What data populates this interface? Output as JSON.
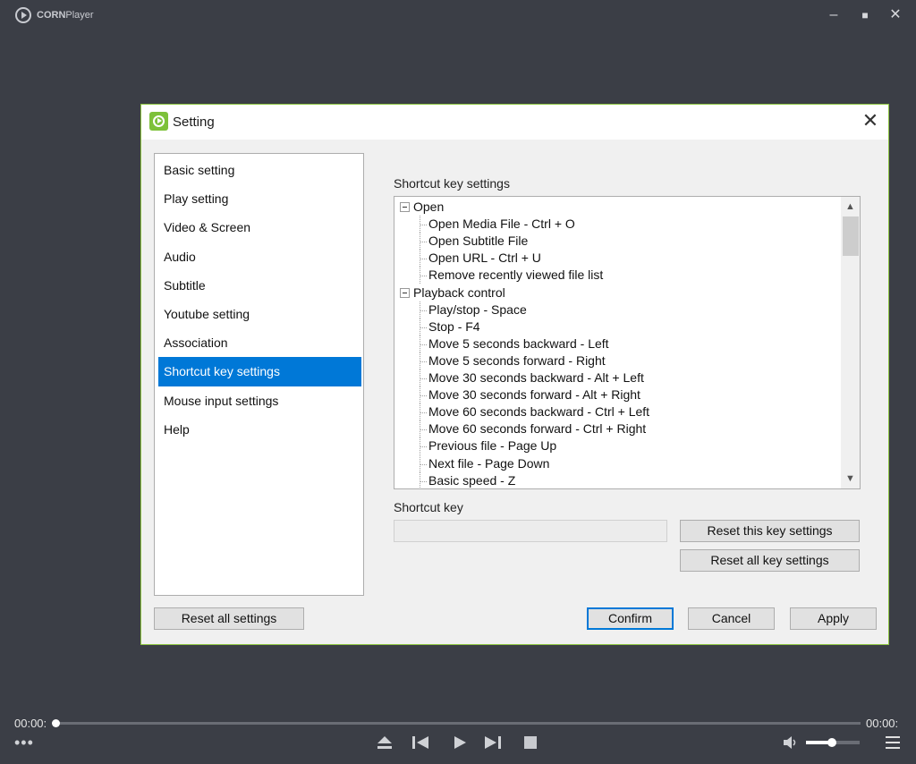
{
  "app": {
    "name_bold": "CORN",
    "name_rest": "Player"
  },
  "window": {
    "minimize": "–",
    "maximize": "■",
    "close": "✕"
  },
  "dialog": {
    "title": "Setting",
    "close": "✕",
    "nav": [
      {
        "label": "Basic setting"
      },
      {
        "label": "Play setting"
      },
      {
        "label": "Video & Screen"
      },
      {
        "label": "Audio"
      },
      {
        "label": "Subtitle"
      },
      {
        "label": "Youtube setting"
      },
      {
        "label": "Association"
      },
      {
        "label": "Shortcut key settings",
        "active": true
      },
      {
        "label": "Mouse input settings"
      },
      {
        "label": "Help"
      }
    ],
    "section_title": "Shortcut key settings",
    "tree": [
      {
        "label": "Open",
        "level": 0
      },
      {
        "label": "Open Media File - Ctrl + O",
        "level": 1
      },
      {
        "label": "Open Subtitle File",
        "level": 1
      },
      {
        "label": "Open URL - Ctrl + U",
        "level": 1
      },
      {
        "label": "Remove recently viewed file list",
        "level": 1
      },
      {
        "label": "Playback control",
        "level": 0
      },
      {
        "label": "Play/stop - Space",
        "level": 1
      },
      {
        "label": "Stop - F4",
        "level": 1
      },
      {
        "label": "Move 5 seconds backward - Left",
        "level": 1
      },
      {
        "label": "Move 5 seconds forward - Right",
        "level": 1
      },
      {
        "label": "Move 30 seconds backward - Alt + Left",
        "level": 1
      },
      {
        "label": "Move 30 seconds forward - Alt + Right",
        "level": 1
      },
      {
        "label": "Move 60 seconds backward - Ctrl + Left",
        "level": 1
      },
      {
        "label": "Move 60 seconds forward - Ctrl + Right",
        "level": 1
      },
      {
        "label": "Previous file - Page Up",
        "level": 1
      },
      {
        "label": "Next file - Page Down",
        "level": 1
      },
      {
        "label": "Basic speed - Z",
        "level": 1
      }
    ],
    "shortcut_key_label": "Shortcut key",
    "shortcut_key_value": "",
    "reset_this_key": "Reset this key settings",
    "reset_all_keys": "Reset all key settings",
    "reset_all_settings": "Reset all settings",
    "confirm": "Confirm",
    "cancel": "Cancel",
    "apply": "Apply"
  },
  "player": {
    "time_current": "00:00:",
    "time_total": "00:00:",
    "volume_level": 0.45,
    "colors": {
      "accent": "#7dc13a",
      "selection": "#0078d7",
      "background": "#3b3e46"
    }
  }
}
